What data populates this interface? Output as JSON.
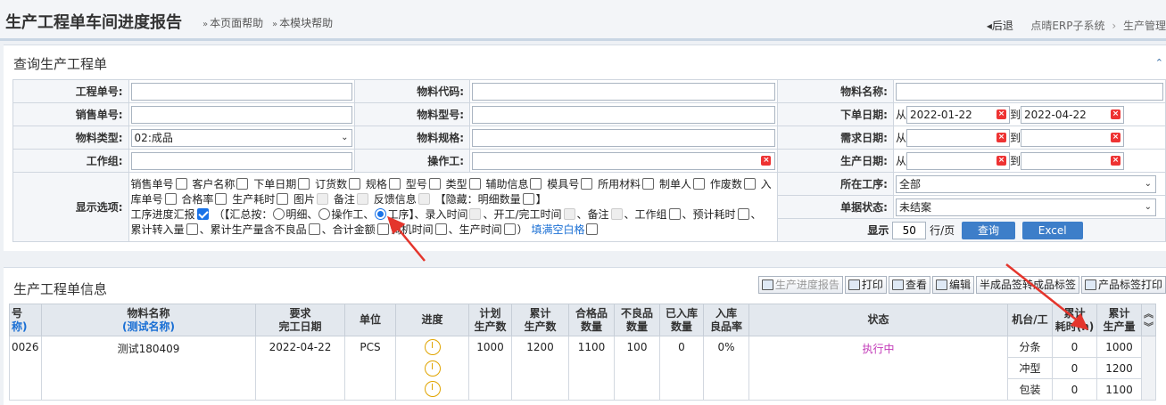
{
  "header": {
    "title": "生产工程单车间进度报告",
    "help_page": "本页面帮助",
    "help_module": "本模块帮助",
    "back": "后退",
    "crumb_1": "点晴ERP子系统",
    "crumb_2": "生产管理"
  },
  "query": {
    "title": "查询生产工程单",
    "labels": {
      "order_no": "工程单号:",
      "material_code": "物料代码:",
      "material_name": "物料名称:",
      "sales_no": "销售单号:",
      "material_model": "物料型号:",
      "order_date": "下单日期:",
      "material_type": "物料类型:",
      "material_spec": "物料规格:",
      "demand_date": "需求日期:",
      "workgroup": "工作组:",
      "operator": "操作工:",
      "production_date": "生产日期:",
      "display_options": "显示选项:",
      "current_process": "所在工序:",
      "doc_status": "单据状态:"
    },
    "material_type_value": "02:成品",
    "from": "从",
    "to": "到",
    "order_date_from": "2022-01-22",
    "order_date_to": "2022-04-22",
    "current_process_value": "全部",
    "doc_status_value": "未结案",
    "display_label": "显示",
    "per_page": "50",
    "per_page_unit": "行/页",
    "search_button": "查询",
    "excel_button": "Excel",
    "options": {
      "sales_no": "销售单号",
      "customer": "客户名称",
      "order_date": "下单日期",
      "deposit": "订货数",
      "spec": "规格",
      "model": "型号",
      "type": "类型",
      "aux": "辅助信息",
      "mold": "模具号",
      "materials": "所用材料",
      "maker": "制单人",
      "scrap": "作废数",
      "in_no_a": "入",
      "in_no_b": "库单号",
      "pass_rate": "合格率",
      "prod_time": "生产耗时",
      "image": "图片",
      "remark": "备注",
      "feedback": "反馈信息",
      "hidden": "【隐藏：明细数量",
      "hidden_end": "】",
      "process_report": "工序进度汇报",
      "summary_open": "（【汇总按：",
      "by_detail": "明细、",
      "by_operator": "操作工、",
      "by_process": "工序】、录入时间",
      "start_finish": "、开工/完工时间",
      "remark2": "、备注",
      "workgroup": "、工作组",
      "est_time": "、预计耗时",
      "cum_transfer": "、",
      "cum_transfer_b": "累计转入量",
      "cum_qty_defect": "、累计生产量含不良品",
      "total_amount": "、合计金额",
      "machine_time": "调机时间",
      "prod_time2": "、生产时间",
      "close": "）",
      "fill_blank": "填满空白格"
    }
  },
  "info": {
    "title": "生产工程单信息",
    "toolbar": {
      "progress_report": "生产进度报告",
      "print": "打印",
      "view": "查看",
      "edit": "编辑",
      "semi_label": "半成品签转成品标签",
      "product_label": "产品标签打印"
    },
    "columns": {
      "c0a": "号",
      "c0b": "称)",
      "material_name": "物料名称",
      "alias": "(测试名称)",
      "due_a": "要求",
      "due_b": "完工日期",
      "unit": "单位",
      "progress": "进度",
      "plan_a": "计划",
      "plan_b": "生产数",
      "cum_a": "累计",
      "cum_b": "生产数",
      "good_a": "合格品",
      "good_b": "数量",
      "bad_a": "不良品",
      "bad_b": "数量",
      "in_a": "已入库",
      "in_b": "数量",
      "rate_a": "入库",
      "rate_b": "良品率",
      "status": "状态",
      "machine": "机台/工",
      "cum_time_a": "累计",
      "cum_time_b": "耗时(h)",
      "cum_out_a": "累计",
      "cum_out_b": "生产量"
    },
    "row": {
      "code": "0026",
      "material_name": "测试180409",
      "due_date": "2022-04-22",
      "unit": "PCS",
      "plan": "1000",
      "cum": "1200",
      "good": "1100",
      "bad": "100",
      "in_stock": "0",
      "rate": "0%",
      "status": "执行中"
    },
    "process_rows": [
      {
        "name": "分条",
        "time": "0",
        "qty": "1000"
      },
      {
        "name": "冲型",
        "time": "0",
        "qty": "1200"
      },
      {
        "name": "包装",
        "time": "0",
        "qty": "1100"
      }
    ]
  }
}
